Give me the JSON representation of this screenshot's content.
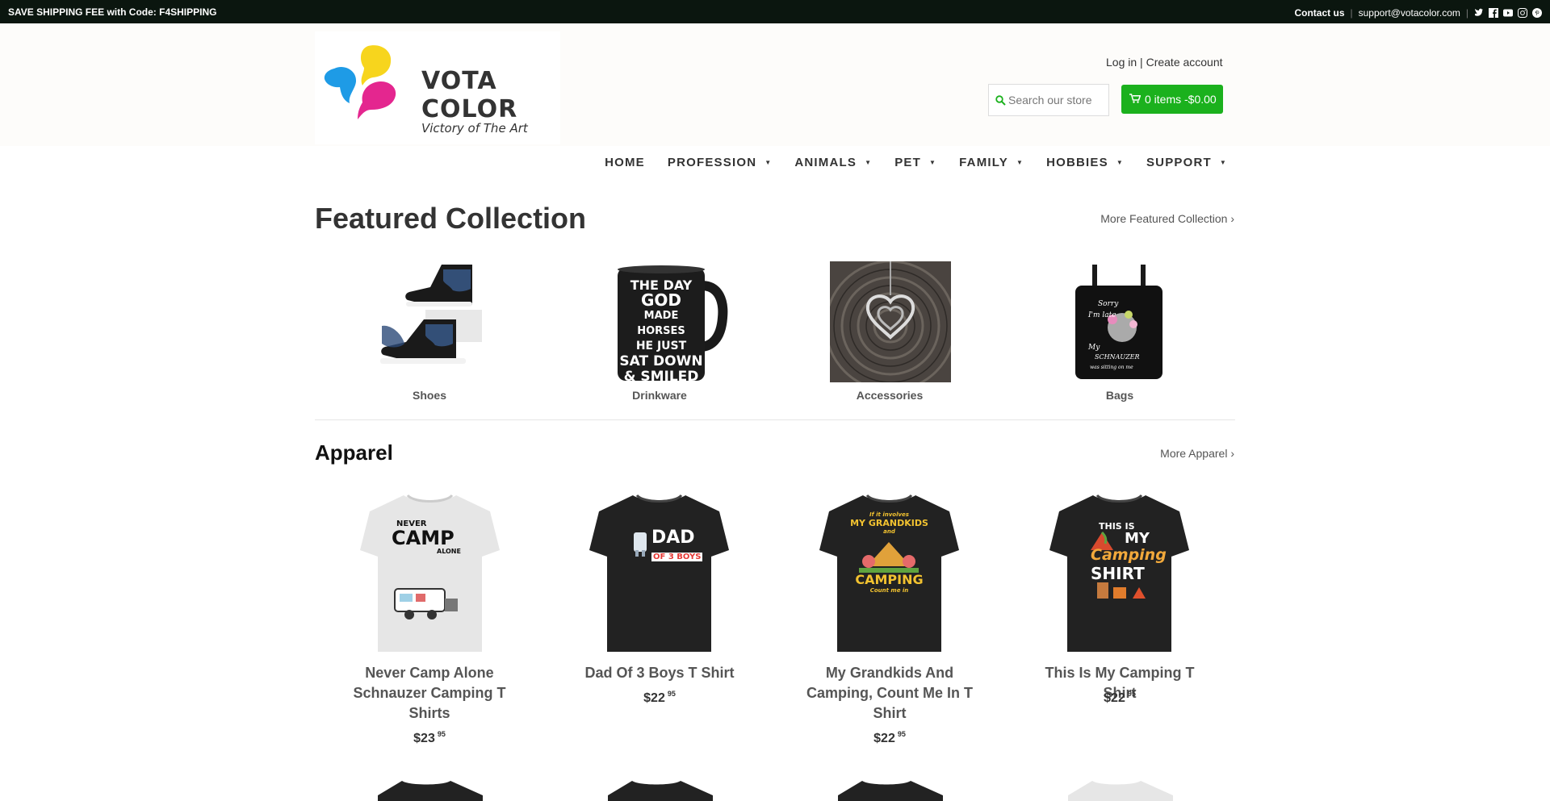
{
  "topbar": {
    "promo": "SAVE SHIPPING FEE with Code: F4SHIPPING",
    "contact": "Contact us",
    "email": "support@votacolor.com",
    "social_icons": [
      "twitter-icon",
      "facebook-icon",
      "youtube-icon",
      "instagram-icon",
      "pinterest-icon"
    ]
  },
  "header": {
    "logo_title": "VOTA COLOR",
    "logo_sub": "Victory of The Art",
    "login": "Log in",
    "account_sep": "|",
    "create_account": "Create account",
    "search_placeholder": "Search our store",
    "cart": "0 items -$0.00"
  },
  "nav": [
    {
      "label": "HOME",
      "dropdown": false
    },
    {
      "label": "PROFESSION",
      "dropdown": true
    },
    {
      "label": "ANIMALS",
      "dropdown": true
    },
    {
      "label": "PET",
      "dropdown": true
    },
    {
      "label": "FAMILY",
      "dropdown": true
    },
    {
      "label": "HOBBIES",
      "dropdown": true
    },
    {
      "label": "SUPPORT",
      "dropdown": true
    }
  ],
  "featured": {
    "title": "Featured Collection",
    "more": "More Featured Collection ›",
    "collections": [
      "Shoes",
      "Drinkware",
      "Accessories",
      "Bags"
    ],
    "mug_text": [
      "THE DAY",
      "GOD",
      "MADE HORSES",
      "HE JUST",
      "SAT DOWN",
      "& SMILED"
    ],
    "bag_text": [
      "Sorry",
      "I'm late",
      "My",
      "SCHNAUZER",
      "was sitting on me"
    ]
  },
  "apparel": {
    "title": "Apparel",
    "more": "More Apparel ›",
    "products": [
      {
        "title": "Never Camp Alone Schnauzer Camping T Shirts",
        "price_main": "$23",
        "price_cents": "95",
        "print_lines": [
          "NEVER",
          "CAMP",
          "ALONE"
        ]
      },
      {
        "title": "Dad Of 3 Boys T Shirt",
        "price_main": "$22",
        "price_cents": "95",
        "print_lines": [
          "DAD",
          "OF 3 BOYS"
        ]
      },
      {
        "title": "My Grandkids And Camping, Count Me In T Shirt",
        "price_main": "$22",
        "price_cents": "95",
        "print_lines": [
          "If it involves",
          "MY GRANDKIDS",
          "and",
          "CAMPING",
          "Count me in"
        ]
      },
      {
        "title": "This Is My Camping T Shirt",
        "price_main": "$22",
        "price_cents": "95",
        "print_lines": [
          "THIS IS",
          "MY",
          "Camping",
          "SHIRT"
        ]
      }
    ]
  }
}
